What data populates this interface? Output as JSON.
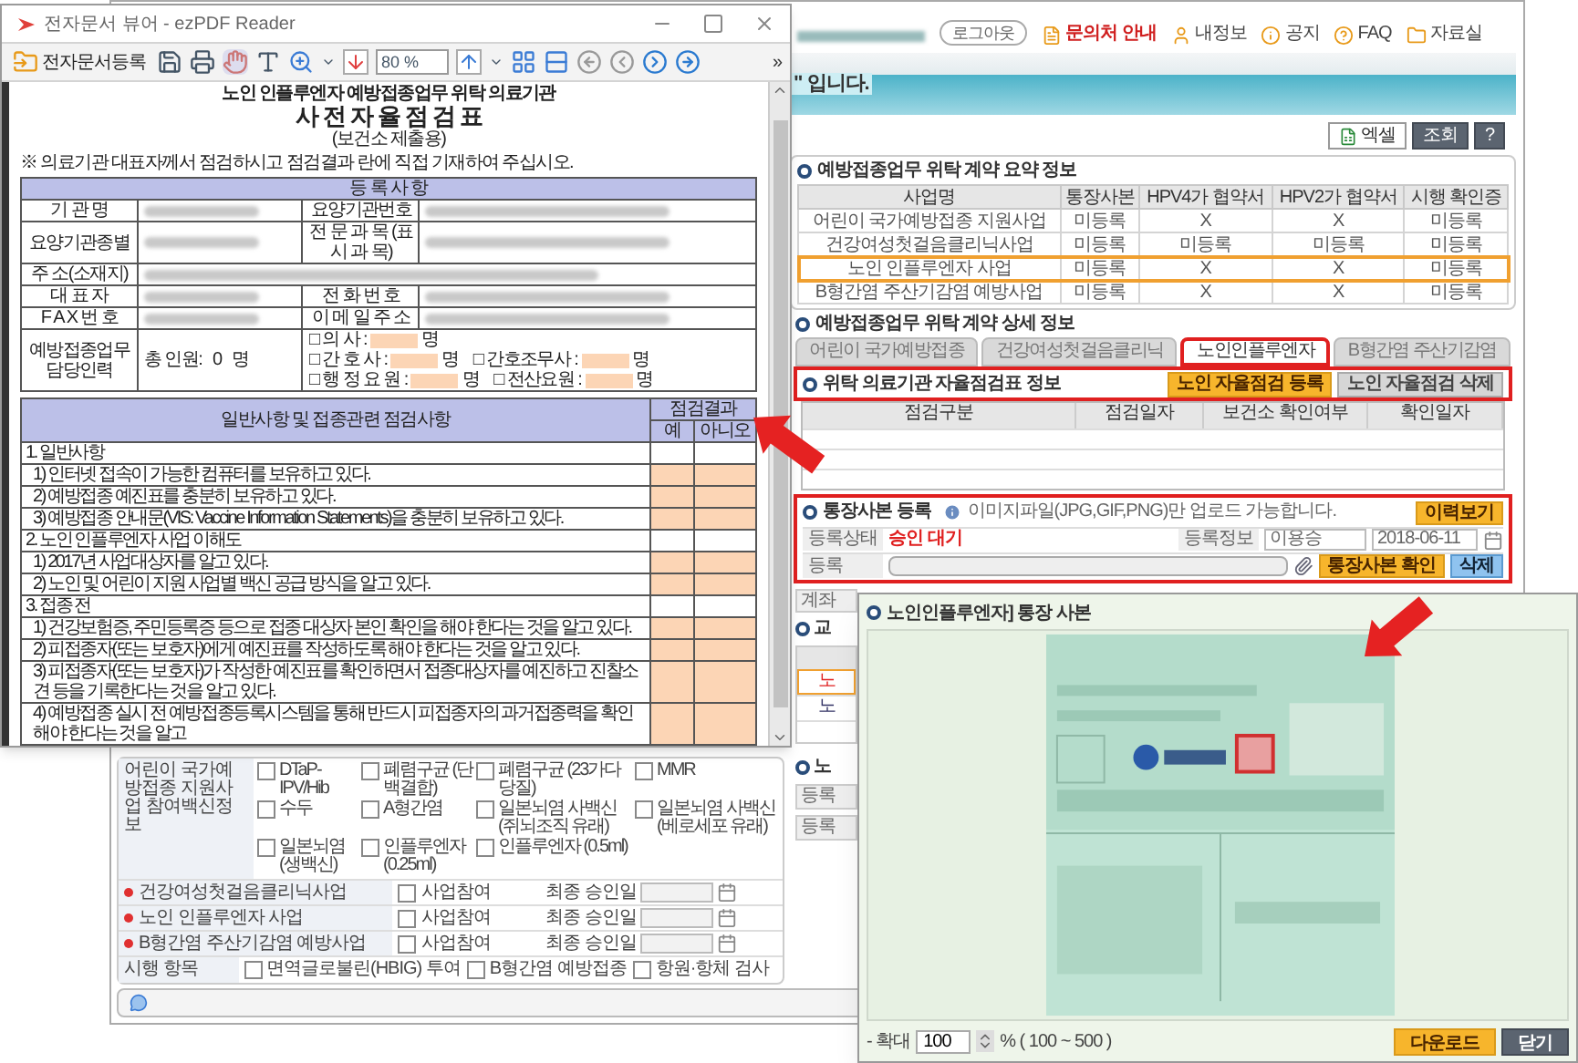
{
  "pdf_viewer": {
    "title": "전자문서 뷰어 - ezPDF Reader",
    "register_button": "전자문서등록",
    "zoom": "80 %",
    "overflow": "»",
    "document": {
      "heading": "노인 인플루엔자 예방접종업무 위탁 의료기관",
      "title": "사 전 자 율 점 검 표",
      "subtitle": "(보건소 제출용)",
      "note": "※ 의료기관 대표자께서 점검하시고 점검결과 란에 직접 기재하여 주십시오.",
      "registration": {
        "heading": "등 록 사 항",
        "rows": [
          [
            {
              "label": "기 관 명",
              "redacted": true
            },
            {
              "label": "요양기관번호",
              "redacted": true
            }
          ],
          [
            {
              "label": "요양기관종별",
              "redacted": true
            },
            {
              "label": "전 문 과 목 (표 시 과 목)",
              "redacted": true
            }
          ],
          [
            {
              "label": "주 소(소재지)",
              "redacted": true
            }
          ],
          [
            {
              "label": "대 표 자",
              "redacted": true
            },
            {
              "label": "전 화 번 호",
              "redacted": true
            }
          ],
          [
            {
              "label": "F A X 번 호",
              "redacted": true
            },
            {
              "label": "이 메 일 주 소",
              "redacted": true
            }
          ]
        ],
        "staffing": {
          "label": "예방접종업무 담당인력",
          "total": "총 인원:   0   명",
          "lines": [
            [
              {
                "label": "□ 의 사 :",
                "unit": "명"
              }
            ],
            [
              {
                "label": "□ 간 호 사 :",
                "unit": "명"
              },
              {
                "label": "□ 간호조무사 :",
                "unit": "명"
              }
            ],
            [
              {
                "label": "□ 행 정 요 원 :",
                "unit": "명"
              },
              {
                "label": "□ 전산요원 :",
                "unit": "명"
              }
            ]
          ]
        }
      },
      "checklist": {
        "heading": "일반사항 및 접종관련 점검사항",
        "result_heading": "점검결과",
        "yes": "예",
        "no": "아니오",
        "items": [
          {
            "kind": "section",
            "text": "1. 일반사항"
          },
          {
            "kind": "item",
            "text": "1) 인터넷 접속이 가능한 컴퓨터를 보유하고 있다."
          },
          {
            "kind": "item",
            "text": "2) 예방접종 예진표를 충분히 보유하고 있다."
          },
          {
            "kind": "item",
            "text": "3) 예방접종 안내문(VIS: Vaccine Information Statements)을 충분히 보유하고 있다."
          },
          {
            "kind": "section",
            "text": "2. 노인 인플루엔자 사업 이해도"
          },
          {
            "kind": "item",
            "text": "1) 2017년 사업대상자를 알고 있다."
          },
          {
            "kind": "item",
            "text": "2) 노인 및 어린이 지원 사업별 백신 공급 방식을 알고 있다."
          },
          {
            "kind": "section",
            "text": "3. 접종 전"
          },
          {
            "kind": "item",
            "text": "1) 건강보험증, 주민등록증 등으로 접종 대상자 본인 확인을 해야 한다는 것을 알고 있다."
          },
          {
            "kind": "item",
            "text": "2) 피접종자(또는 보호자)에게 예진표를 작성하도록 해야 한다는 것을 알고 있다."
          },
          {
            "kind": "item",
            "text": "3) 피접종자(또는 보호자)가 작성한 예진표를 확인하면서 접종대상자를 예진하고 진찰소견 등을 기록한다는 것을 알고 있다."
          },
          {
            "kind": "item",
            "text": "4) 예방접종 실시 전 예방접종등록시스템을 통해 반드시 피접종자의 과거접종력을 확인해야 한다는 것을 알고"
          }
        ]
      }
    }
  },
  "web": {
    "user": {
      "redacted": true
    },
    "logout": "로그아웃",
    "links": [
      {
        "label": "문의처 안내",
        "emphasis": true
      },
      {
        "label": "내정보",
        "emphasis": false
      },
      {
        "label": "공지",
        "emphasis": false
      },
      {
        "label": "FAQ",
        "emphasis": false
      },
      {
        "label": "자료실",
        "emphasis": false
      }
    ],
    "banner_text": "\" 입니다.",
    "toolbar": [
      {
        "label": "엑셀",
        "kind": "excel"
      },
      {
        "label": "조회",
        "kind": "dark"
      },
      {
        "label": "?",
        "kind": "dark"
      }
    ],
    "summary": {
      "title": "예방접종업무 위탁 계약 요약 정보",
      "columns": [
        "사업명",
        "통장사본",
        "HPV4가 협약서",
        "HPV2가 협약서",
        "시행 확인증"
      ],
      "rows": [
        {
          "cells": [
            "어린이 국가예방접종 지원사업",
            "미등록",
            "X",
            "X",
            "미등록"
          ],
          "highlighted": false
        },
        {
          "cells": [
            "건강여성첫걸음클리닉사업",
            "미등록",
            "미등록",
            "미등록",
            "미등록"
          ],
          "highlighted": false
        },
        {
          "cells": [
            "노인 인플루엔자 사업",
            "미등록",
            "X",
            "X",
            "미등록"
          ],
          "highlighted": true
        },
        {
          "cells": [
            "B형간염 주산기감염 예방사업",
            "미등록",
            "X",
            "X",
            "미등록"
          ],
          "highlighted": false
        }
      ]
    },
    "detail": {
      "title": "예방접종업무 위탁 계약 상세 정보",
      "tabs": [
        {
          "label": "어린이 국가예방접종",
          "selected": false
        },
        {
          "label": "건강여성첫걸음클리닉",
          "selected": false
        },
        {
          "label": "노인인플루엔자",
          "selected": true
        },
        {
          "label": "B형간염 주산기감염",
          "selected": false
        }
      ]
    },
    "self_check": {
      "title": "위탁 의료기관 자율점검표 정보",
      "buttons": [
        {
          "label": "노인 자율점검 등록",
          "kind": "primary"
        },
        {
          "label": "노인 자율점검 삭제",
          "kind": "secondary"
        }
      ],
      "columns": [
        "점검구분",
        "점검일자",
        "보건소 확인여부",
        "확인일자"
      ]
    },
    "bankbook": {
      "title": "통장사본 등록",
      "info": "이미지파일(JPG,GIF,PNG)만 업로드 가능합니다.",
      "history_button": "이력보기",
      "status_label": "등록상태",
      "status": "승인 대기",
      "info_label": "등록정보",
      "registrant": "이용승",
      "date": "2018-06-11",
      "file_label": "등록",
      "buttons": [
        {
          "label": "통장사본 확인",
          "kind": "primary"
        },
        {
          "label": "삭제",
          "kind": "blue"
        }
      ]
    },
    "lower": {
      "account_label": "계좌",
      "education_title": "교",
      "education_rows": [
        {
          "text": "노",
          "selected": true
        },
        {
          "text": "노",
          "selected": false
        }
      ],
      "flu_title": "노",
      "flu_rows": [
        "등록",
        "등록"
      ]
    },
    "form": {
      "vaccine_label": "어린이 국가예방접종 지원사업 참여백신정보",
      "vaccines": [
        {
          "label": "DTaP-IPV/Hib",
          "checked": false
        },
        {
          "label": "폐렴구균 (단백결합)",
          "checked": false
        },
        {
          "label": "폐렴구균 (23가다당질)",
          "checked": false
        },
        {
          "label": "MMR",
          "checked": false
        },
        {
          "label": "수두",
          "checked": false
        },
        {
          "label": "A형간염",
          "checked": false
        },
        {
          "label": "일본뇌염 사백신 (쥐뇌조직 유래)",
          "checked": false
        },
        {
          "label": "일본뇌염 사백신 (베로세포 유래)",
          "checked": false
        },
        {
          "label": "일본뇌염 (생백신)",
          "checked": false
        },
        {
          "label": "인플루엔자 (0.25ml)",
          "checked": false
        },
        {
          "label": "인플루엔자 (0.5ml)",
          "checked": false
        }
      ],
      "programs": [
        {
          "name": "건강여성첫걸음클리닉사업",
          "required": true,
          "option": "사업참여",
          "checked": false,
          "date_label": "최종 승인일"
        },
        {
          "name": "노인 인플루엔자 사업",
          "required": true,
          "option": "사업참여",
          "checked": false,
          "date_label": "최종 승인일"
        },
        {
          "name": "B형간염 주산기감염 예방사업",
          "required": true,
          "option": "사업참여",
          "checked": false,
          "date_label": "최종 승인일"
        }
      ],
      "items_label": "시행 항목",
      "items": [
        {
          "label": "면역글로불린(HBIG) 투여",
          "checked": false
        },
        {
          "label": "B형간염 예방접종",
          "checked": false
        },
        {
          "label": "항원·항체 검사",
          "checked": false
        }
      ]
    }
  },
  "popup": {
    "title": "노인인플루엔자] 통장 사본",
    "zoom_label": "- 확대",
    "zoom": "100",
    "zoom_range": "% ( 100 ~ 500 )",
    "buttons": [
      {
        "label": "다운로드",
        "kind": "primary"
      },
      {
        "label": "닫기",
        "kind": "dark"
      }
    ]
  }
}
